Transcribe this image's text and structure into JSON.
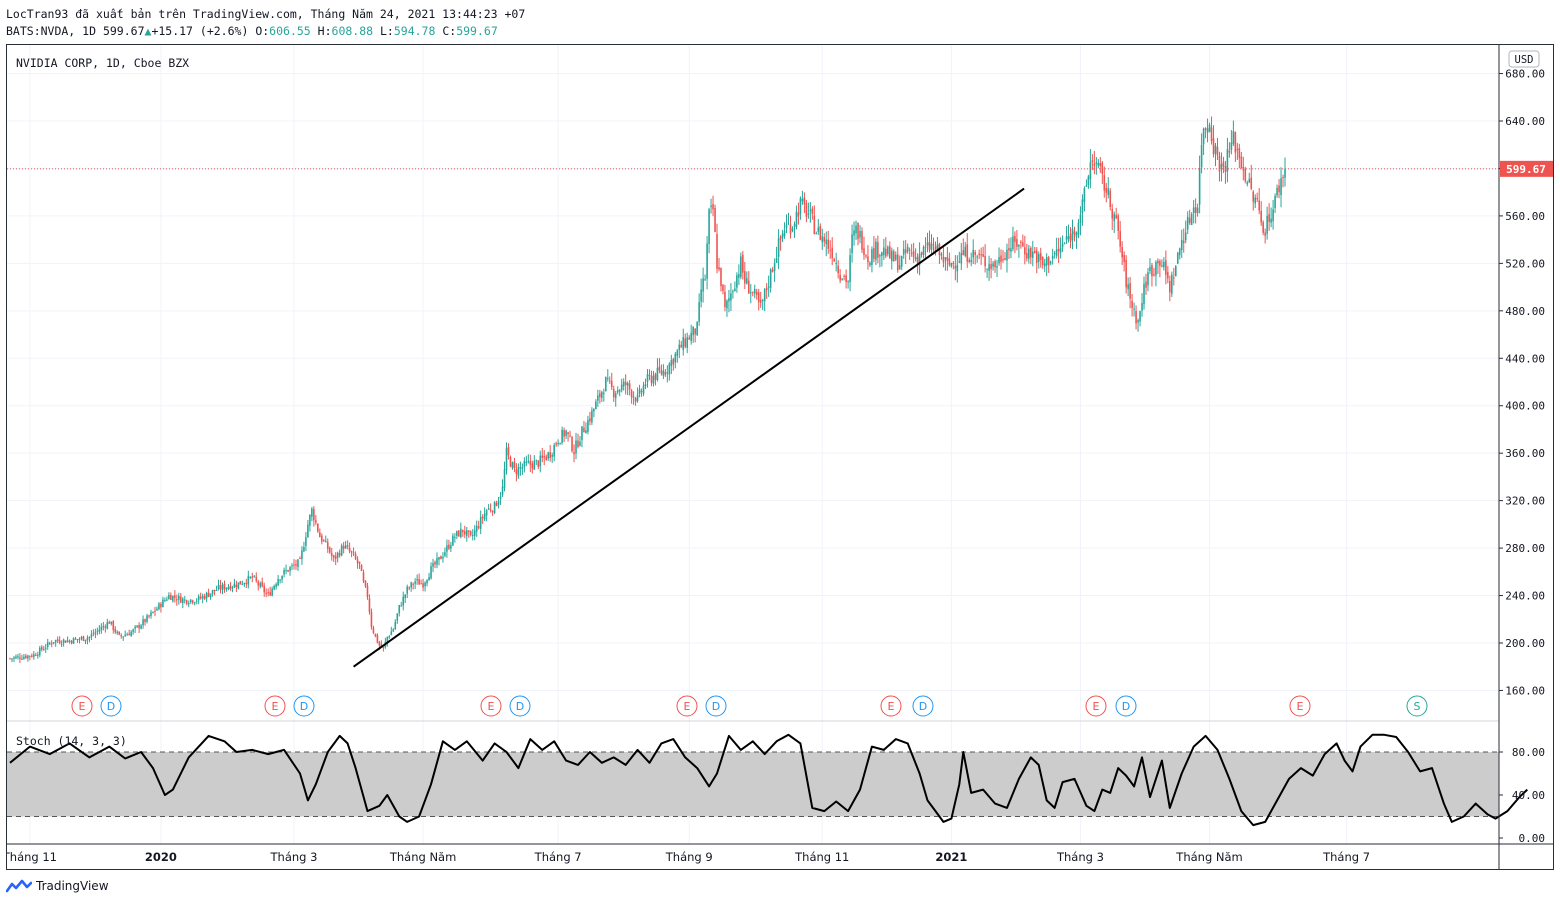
{
  "header": {
    "line1": "LocTran93 đã xuất bản trên TradingView.com, Tháng Năm 24, 2021 13:44:23 +07",
    "symbol": "BATS:NVDA, 1D",
    "last": "599.67",
    "change_arrow": "▲",
    "change": "+15.17 (+2.6%)",
    "o_label": "O:",
    "o_value": "606.55",
    "h_label": "H:",
    "h_value": "608.88",
    "l_label": "L:",
    "l_value": "594.78",
    "c_label": "C:",
    "c_value": "599.67"
  },
  "legend": {
    "price_title": "NVIDIA CORP, 1D, Cboe BZX",
    "stoch_title": "Stoch (14, 3, 3)"
  },
  "currency": "USD",
  "colors": {
    "up": "#26a69a",
    "down": "#ef5350",
    "last_price_label": "#ef5350",
    "trendline": "#000000",
    "stoch_band": "#cccccc"
  },
  "footer": {
    "logo_icon": "tradingview-logo-icon",
    "brand": "TradingView"
  },
  "chart_data": [
    {
      "type": "candlestick",
      "ylim": [
        150,
        690
      ],
      "y_ticks": [
        "680.00",
        "640.00",
        "600.00",
        "560.00",
        "520.00",
        "480.00",
        "440.00",
        "400.00",
        "360.00",
        "320.00",
        "280.00",
        "240.00",
        "200.00",
        "160.00"
      ],
      "x_ticks": [
        "Tháng 11",
        "2020",
        "Tháng 3",
        "Tháng Năm",
        "Tháng 7",
        "Tháng 9",
        "Tháng 11",
        "2021",
        "Tháng 3",
        "Tháng Năm",
        "Tháng 7"
      ],
      "x_ticks_bold": [
        "2020",
        "2021"
      ],
      "last_price": "599.67",
      "price_path": [
        [
          0,
          187
        ],
        [
          12,
          190
        ],
        [
          22,
          202
        ],
        [
          30,
          202
        ],
        [
          40,
          205
        ],
        [
          50,
          218
        ],
        [
          55,
          205
        ],
        [
          62,
          210
        ],
        [
          70,
          222
        ],
        [
          80,
          240
        ],
        [
          88,
          236
        ],
        [
          95,
          237
        ],
        [
          105,
          246
        ],
        [
          115,
          250
        ],
        [
          122,
          255
        ],
        [
          130,
          240
        ],
        [
          135,
          255
        ],
        [
          140,
          262
        ],
        [
          146,
          268
        ],
        [
          150,
          300
        ],
        [
          152,
          312
        ],
        [
          156,
          290
        ],
        [
          160,
          280
        ],
        [
          163,
          270
        ],
        [
          168,
          282
        ],
        [
          172,
          275
        ],
        [
          176,
          265
        ],
        [
          178,
          250
        ],
        [
          180,
          240
        ],
        [
          182,
          215
        ],
        [
          184,
          205
        ],
        [
          186,
          198
        ],
        [
          188,
          195
        ],
        [
          190,
          205
        ],
        [
          193,
          212
        ],
        [
          196,
          230
        ],
        [
          200,
          245
        ],
        [
          204,
          252
        ],
        [
          208,
          250
        ],
        [
          212,
          262
        ],
        [
          216,
          270
        ],
        [
          220,
          280
        ],
        [
          224,
          290
        ],
        [
          228,
          295
        ],
        [
          232,
          288
        ],
        [
          236,
          300
        ],
        [
          240,
          312
        ],
        [
          244,
          315
        ],
        [
          248,
          330
        ],
        [
          250,
          360
        ],
        [
          254,
          345
        ],
        [
          260,
          350
        ],
        [
          266,
          352
        ],
        [
          272,
          360
        ],
        [
          276,
          372
        ],
        [
          280,
          378
        ],
        [
          284,
          362
        ],
        [
          288,
          378
        ],
        [
          292,
          390
        ],
        [
          296,
          405
        ],
        [
          300,
          420
        ],
        [
          304,
          412
        ],
        [
          310,
          418
        ],
        [
          316,
          405
        ],
        [
          320,
          420
        ],
        [
          324,
          425
        ],
        [
          330,
          430
        ],
        [
          334,
          440
        ],
        [
          338,
          450
        ],
        [
          342,
          458
        ],
        [
          346,
          465
        ],
        [
          348,
          498
        ],
        [
          350,
          508
        ],
        [
          352,
          560
        ],
        [
          354,
          565
        ],
        [
          356,
          520
        ],
        [
          358,
          505
        ],
        [
          360,
          480
        ],
        [
          364,
          500
        ],
        [
          368,
          520
        ],
        [
          370,
          505
        ],
        [
          374,
          495
        ],
        [
          378,
          482
        ],
        [
          382,
          505
        ],
        [
          386,
          530
        ],
        [
          390,
          550
        ],
        [
          394,
          553
        ],
        [
          398,
          570
        ],
        [
          402,
          562
        ],
        [
          406,
          548
        ],
        [
          410,
          540
        ],
        [
          414,
          530
        ],
        [
          418,
          512
        ],
        [
          422,
          505
        ],
        [
          424,
          540
        ],
        [
          426,
          548
        ],
        [
          428,
          543
        ],
        [
          432,
          525
        ],
        [
          436,
          532
        ],
        [
          440,
          531
        ],
        [
          444,
          524
        ],
        [
          448,
          520
        ],
        [
          452,
          531
        ],
        [
          456,
          525
        ],
        [
          460,
          530
        ],
        [
          464,
          535
        ],
        [
          468,
          528
        ],
        [
          472,
          518
        ],
        [
          476,
          522
        ],
        [
          480,
          528
        ],
        [
          484,
          528
        ],
        [
          488,
          525
        ],
        [
          492,
          520
        ],
        [
          496,
          518
        ],
        [
          500,
          528
        ],
        [
          504,
          535
        ],
        [
          508,
          538
        ],
        [
          512,
          530
        ],
        [
          516,
          528
        ],
        [
          520,
          518
        ],
        [
          524,
          525
        ],
        [
          528,
          530
        ],
        [
          532,
          540
        ],
        [
          536,
          548
        ],
        [
          540,
          568
        ],
        [
          542,
          585
        ],
        [
          544,
          605
        ],
        [
          546,
          607
        ],
        [
          548,
          600
        ],
        [
          550,
          590
        ],
        [
          552,
          582
        ],
        [
          554,
          570
        ],
        [
          556,
          560
        ],
        [
          558,
          545
        ],
        [
          560,
          525
        ],
        [
          562,
          505
        ],
        [
          564,
          490
        ],
        [
          566,
          480
        ],
        [
          568,
          470
        ],
        [
          570,
          490
        ],
        [
          572,
          505
        ],
        [
          574,
          515
        ],
        [
          576,
          515
        ],
        [
          578,
          525
        ],
        [
          580,
          520
        ],
        [
          582,
          510
        ],
        [
          584,
          500
        ],
        [
          586,
          512
        ],
        [
          588,
          525
        ],
        [
          590,
          540
        ],
        [
          592,
          548
        ],
        [
          594,
          558
        ],
        [
          596,
          568
        ],
        [
          598,
          570
        ],
        [
          600,
          625
        ],
        [
          602,
          635
        ],
        [
          604,
          640
        ],
        [
          606,
          620
        ],
        [
          608,
          610
        ],
        [
          610,
          600
        ],
        [
          612,
          605
        ],
        [
          614,
          615
        ],
        [
          616,
          625
        ],
        [
          618,
          615
        ],
        [
          620,
          605
        ],
        [
          622,
          595
        ],
        [
          624,
          585
        ],
        [
          626,
          575
        ],
        [
          628,
          570
        ],
        [
          630,
          555
        ],
        [
          632,
          550
        ],
        [
          634,
          560
        ],
        [
          636,
          565
        ],
        [
          638,
          580
        ],
        [
          640,
          590
        ],
        [
          642,
          599.67
        ]
      ],
      "trendline": {
        "start": {
          "date": "2020-03-18",
          "price": 180
        },
        "end": {
          "date": "2021-07-20",
          "price": 583
        }
      },
      "events": [
        {
          "label": "E",
          "type": "earnings"
        },
        {
          "label": "D",
          "type": "dividend"
        },
        {
          "label": "E",
          "type": "earnings"
        },
        {
          "label": "D",
          "type": "dividend"
        },
        {
          "label": "E",
          "type": "earnings"
        },
        {
          "label": "D",
          "type": "dividend"
        },
        {
          "label": "E",
          "type": "earnings"
        },
        {
          "label": "D",
          "type": "dividend"
        },
        {
          "label": "E",
          "type": "earnings"
        },
        {
          "label": "D",
          "type": "dividend"
        },
        {
          "label": "E",
          "type": "earnings"
        },
        {
          "label": "D",
          "type": "dividend"
        },
        {
          "label": "E",
          "type": "earnings"
        },
        {
          "label": "S",
          "type": "split"
        }
      ]
    },
    {
      "type": "line",
      "title": "Stoch (14, 3, 3)",
      "ylim": [
        -8,
        105
      ],
      "y_ticks": [
        "80.00",
        "40.00",
        "0.00"
      ],
      "band": [
        20,
        80
      ],
      "path": [
        [
          0,
          70
        ],
        [
          10,
          85
        ],
        [
          20,
          78
        ],
        [
          30,
          88
        ],
        [
          40,
          75
        ],
        [
          50,
          85
        ],
        [
          58,
          74
        ],
        [
          66,
          80
        ],
        [
          72,
          65
        ],
        [
          78,
          40
        ],
        [
          82,
          45
        ],
        [
          90,
          75
        ],
        [
          100,
          95
        ],
        [
          108,
          90
        ],
        [
          114,
          80
        ],
        [
          122,
          82
        ],
        [
          130,
          78
        ],
        [
          138,
          82
        ],
        [
          146,
          60
        ],
        [
          150,
          35
        ],
        [
          154,
          50
        ],
        [
          160,
          80
        ],
        [
          166,
          95
        ],
        [
          170,
          88
        ],
        [
          174,
          65
        ],
        [
          180,
          25
        ],
        [
          186,
          30
        ],
        [
          190,
          40
        ],
        [
          196,
          20
        ],
        [
          200,
          15
        ],
        [
          206,
          20
        ],
        [
          212,
          50
        ],
        [
          218,
          90
        ],
        [
          224,
          82
        ],
        [
          230,
          90
        ],
        [
          238,
          72
        ],
        [
          244,
          88
        ],
        [
          250,
          80
        ],
        [
          256,
          65
        ],
        [
          262,
          92
        ],
        [
          268,
          82
        ],
        [
          274,
          90
        ],
        [
          280,
          72
        ],
        [
          286,
          68
        ],
        [
          292,
          80
        ],
        [
          298,
          70
        ],
        [
          304,
          75
        ],
        [
          310,
          68
        ],
        [
          316,
          82
        ],
        [
          322,
          70
        ],
        [
          328,
          88
        ],
        [
          334,
          92
        ],
        [
          340,
          75
        ],
        [
          346,
          65
        ],
        [
          352,
          48
        ],
        [
          356,
          60
        ],
        [
          362,
          95
        ],
        [
          368,
          82
        ],
        [
          374,
          90
        ],
        [
          380,
          78
        ],
        [
          386,
          90
        ],
        [
          392,
          96
        ],
        [
          398,
          88
        ],
        [
          404,
          28
        ],
        [
          410,
          25
        ],
        [
          416,
          34
        ],
        [
          422,
          25
        ],
        [
          428,
          45
        ],
        [
          434,
          85
        ],
        [
          440,
          82
        ],
        [
          446,
          92
        ],
        [
          452,
          88
        ],
        [
          458,
          60
        ],
        [
          462,
          35
        ],
        [
          466,
          25
        ],
        [
          470,
          15
        ],
        [
          474,
          18
        ],
        [
          478,
          50
        ],
        [
          480,
          80
        ],
        [
          484,
          42
        ],
        [
          490,
          45
        ],
        [
          496,
          32
        ],
        [
          502,
          28
        ],
        [
          508,
          55
        ],
        [
          514,
          75
        ],
        [
          518,
          68
        ],
        [
          522,
          35
        ],
        [
          526,
          28
        ],
        [
          530,
          52
        ],
        [
          536,
          55
        ],
        [
          542,
          30
        ],
        [
          546,
          25
        ],
        [
          550,
          45
        ],
        [
          554,
          42
        ],
        [
          558,
          65
        ],
        [
          562,
          58
        ],
        [
          566,
          48
        ],
        [
          570,
          75
        ],
        [
          574,
          38
        ],
        [
          580,
          72
        ],
        [
          584,
          28
        ],
        [
          590,
          60
        ],
        [
          596,
          85
        ],
        [
          602,
          95
        ],
        [
          608,
          82
        ],
        [
          614,
          55
        ],
        [
          620,
          25
        ],
        [
          626,
          12
        ],
        [
          632,
          15
        ],
        [
          638,
          35
        ],
        [
          644,
          55
        ],
        [
          650,
          65
        ],
        [
          656,
          58
        ],
        [
          662,
          78
        ],
        [
          668,
          88
        ],
        [
          672,
          72
        ],
        [
          676,
          62
        ],
        [
          680,
          85
        ],
        [
          686,
          96
        ],
        [
          692,
          96
        ],
        [
          698,
          94
        ],
        [
          704,
          80
        ],
        [
          710,
          62
        ],
        [
          716,
          65
        ],
        [
          722,
          32
        ],
        [
          726,
          15
        ],
        [
          732,
          20
        ],
        [
          738,
          32
        ],
        [
          744,
          22
        ],
        [
          748,
          18
        ],
        [
          754,
          25
        ],
        [
          760,
          38
        ],
        [
          764,
          45
        ]
      ]
    }
  ]
}
